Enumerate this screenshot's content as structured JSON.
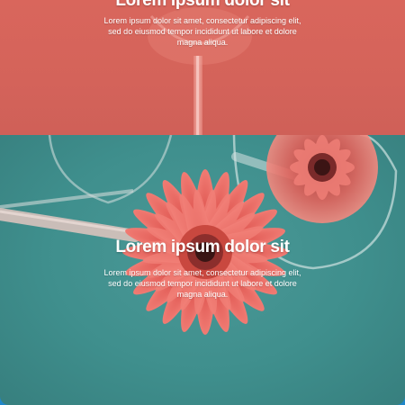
{
  "sections": [
    {
      "heading": "Lorem ipsum dolor sit",
      "body": "Lorem ipsum dolor sit amet, consectetur adipiscing elit, sed do eiusmod tempor incididunt ut labore et dolore magna aliqua."
    },
    {
      "heading": "Lorem ipsum dolor sit",
      "body": "Lorem ipsum dolor sit amet, consectetur adipiscing elit, sed do eiusmod tempor incididunt ut labore et dolore magna aliqua."
    }
  ],
  "colors": {
    "top_panel": "#d9665c",
    "photo_background": "#3f8f8d",
    "flower": "#e8605a",
    "frame_accent": "#1f86c9",
    "text": "#ffffff"
  }
}
